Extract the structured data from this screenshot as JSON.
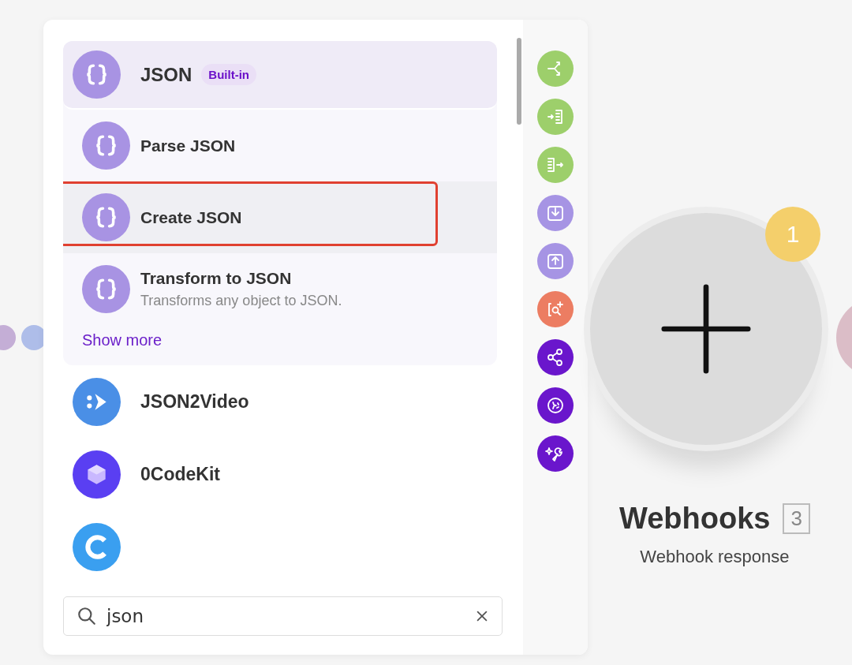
{
  "group": {
    "name": "JSON",
    "badge": "Built-in",
    "expanded": true
  },
  "modules": [
    {
      "name": "Parse JSON",
      "selected": false,
      "highlighted": false
    },
    {
      "name": "Create JSON",
      "selected": true,
      "highlighted": true
    },
    {
      "name": "Transform to JSON",
      "description": "Transforms any object to JSON.",
      "selected": false,
      "highlighted": false
    }
  ],
  "show_more": "Show more",
  "apps": [
    {
      "name": "JSON2Video",
      "kind": "play",
      "color": "#4a8fe6"
    },
    {
      "name": "0CodeKit",
      "kind": "cube",
      "color": "#5a3ff2"
    },
    {
      "kind": "chat",
      "color": "#3a9ff0"
    }
  ],
  "search": {
    "value": "json"
  },
  "tools": [
    {
      "kind": "router",
      "color": "#9dcf6b"
    },
    {
      "kind": "iterator",
      "color": "#9dcf6b"
    },
    {
      "kind": "aggregator",
      "color": "#9dcf6b"
    },
    {
      "kind": "download",
      "color": "#a694e4"
    },
    {
      "kind": "upload",
      "color": "#a694e4"
    },
    {
      "kind": "search",
      "color": "#ec7d62"
    },
    {
      "kind": "share",
      "color": "#6a16cc"
    },
    {
      "kind": "sparkle",
      "color": "#6a16cc"
    },
    {
      "kind": "wrench",
      "color": "#6a16cc"
    }
  ],
  "node": {
    "title": "Webhooks",
    "number": "3",
    "subtitle": "Webhook response",
    "badge": "1"
  }
}
